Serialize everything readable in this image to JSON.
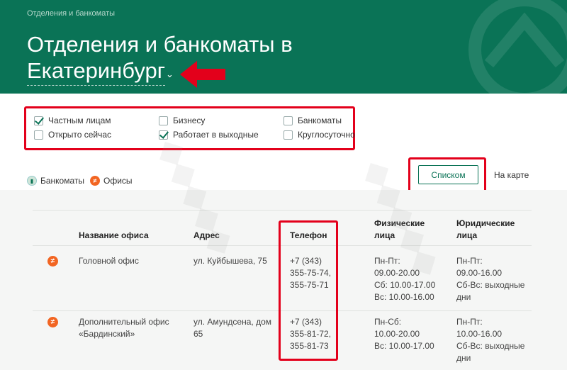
{
  "header": {
    "breadcrumb": "Отделения и банкоматы",
    "title_line1": "Отделения и банкоматы в",
    "title_city": "Екатеринбург",
    "chevron": "⌄"
  },
  "filters": [
    {
      "label": "Частным лицам",
      "checked": true
    },
    {
      "label": "Открыто сейчас",
      "checked": false
    },
    {
      "label": "Бизнесу",
      "checked": false
    },
    {
      "label": "Работает в выходные",
      "checked": true
    },
    {
      "label": "Банкоматы",
      "checked": false
    },
    {
      "label": "Круглосуточно",
      "checked": false
    }
  ],
  "legend": {
    "atms": "Банкоматы",
    "offices": "Офисы"
  },
  "view": {
    "list": "Списком",
    "map": "На карте"
  },
  "table": {
    "headers": {
      "name": "Название офиса",
      "address": "Адрес",
      "phone": "Телефон",
      "individuals": [
        "Физические",
        "лица"
      ],
      "legal": [
        "Юридические",
        "лица"
      ]
    },
    "rows": [
      {
        "name": [
          "Головной офис"
        ],
        "address": [
          "ул. Куйбышева, 75"
        ],
        "phone": [
          "+7 (343)",
          "355-75-74,",
          "355-75-71"
        ],
        "individuals": [
          "Пн-Пт:",
          "09.00-20.00",
          "Сб: 10.00-17.00",
          "Вс: 10.00-16.00"
        ],
        "legal": [
          "Пн-Пт:",
          "09.00-16.00",
          "Сб-Вс: выходные",
          "дни"
        ]
      },
      {
        "name": [
          "Дополнительный офис",
          "«Бардинский»"
        ],
        "address": [
          "ул. Амундсена, дом",
          "65"
        ],
        "phone": [
          "+7 (343)",
          "355-81-72,",
          "355-81-73"
        ],
        "individuals": [
          "Пн-Сб:",
          "10.00-20.00",
          "Вс: 10.00-17.00"
        ],
        "legal": [
          "Пн-Пт:",
          "10.00-16.00",
          "Сб-Вс: выходные",
          "дни"
        ]
      }
    ]
  },
  "colors": {
    "brand": "#0a7356",
    "accent": "#f26522",
    "highlight": "#e3001b"
  }
}
